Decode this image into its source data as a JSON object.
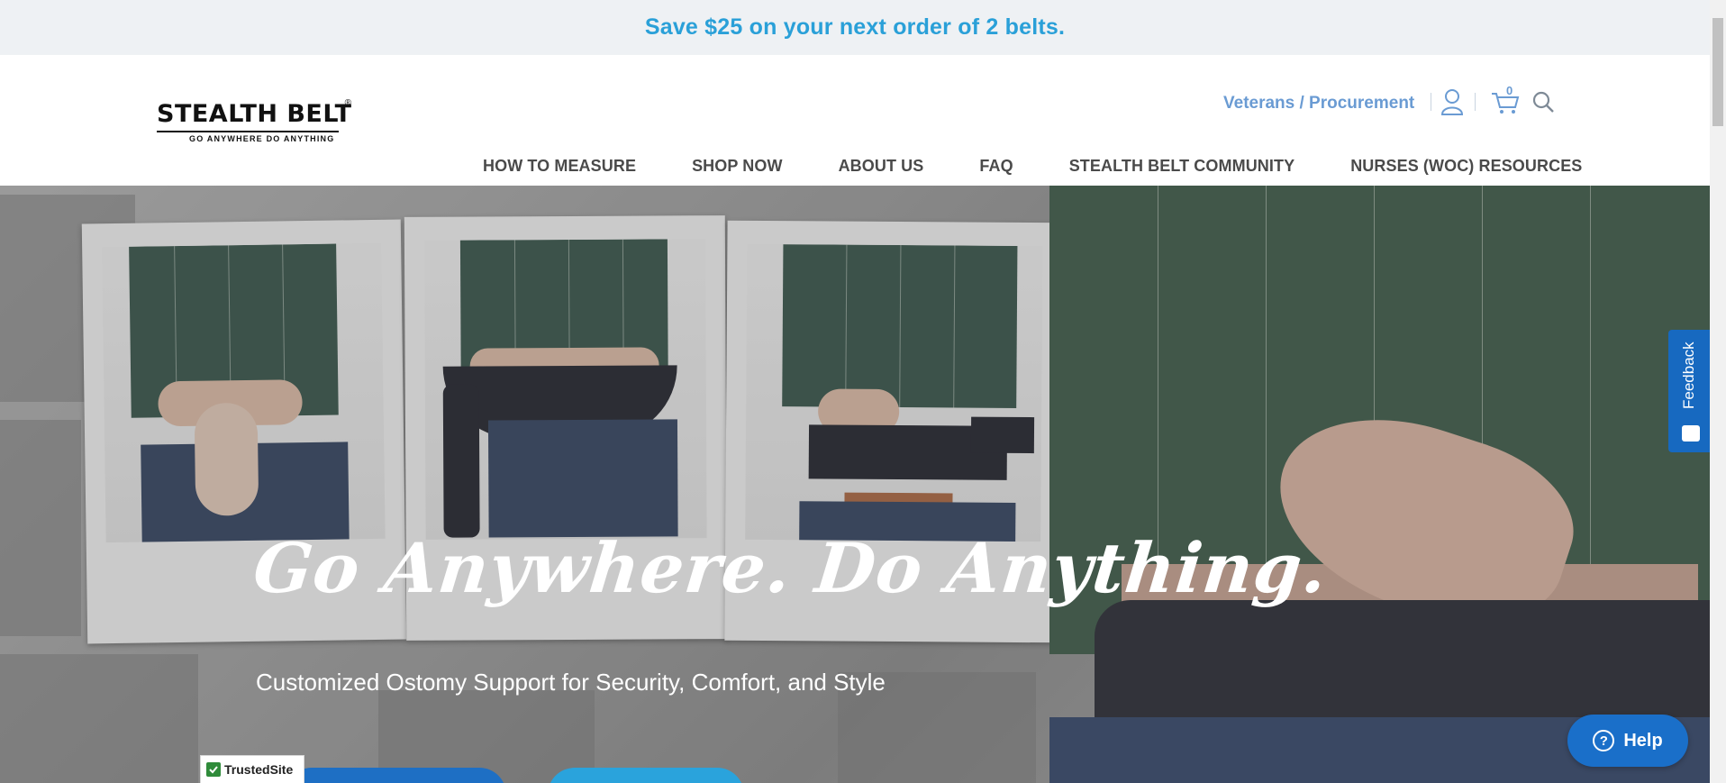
{
  "promo": {
    "text": "Save $25 on your next order of 2 belts."
  },
  "logo": {
    "name": "STEALTH BELT",
    "reg": "®",
    "tagline": "GO ANYWHERE DO ANYTHING"
  },
  "header": {
    "veterans_link": "Veterans / Procurement",
    "account_icon": "user-icon",
    "cart_icon": "cart-icon",
    "cart_count": "0",
    "search_icon": "search-icon"
  },
  "nav": {
    "items": [
      {
        "label": "HOW TO MEASURE"
      },
      {
        "label": "SHOP NOW"
      },
      {
        "label": "ABOUT US"
      },
      {
        "label": "FAQ"
      },
      {
        "label": "STEALTH BELT COMMUNITY"
      },
      {
        "label": "NURSES (WOC) RESOURCES"
      }
    ]
  },
  "hero": {
    "heading": "Go Anywhere. Do Anything.",
    "subheading": "Customized Ostomy Support for Security, Comfort, and Style"
  },
  "trusted_badge": {
    "label": "TrustedSite"
  },
  "feedback": {
    "label": "Feedback"
  },
  "help": {
    "label": "Help",
    "icon": "question-icon"
  },
  "colors": {
    "promo_text": "#2aa0d8",
    "link": "#6a9bd3",
    "nav_text": "#4a4a4a",
    "help_bg": "#1a6fc9",
    "feedback_bg": "#1769c0"
  }
}
